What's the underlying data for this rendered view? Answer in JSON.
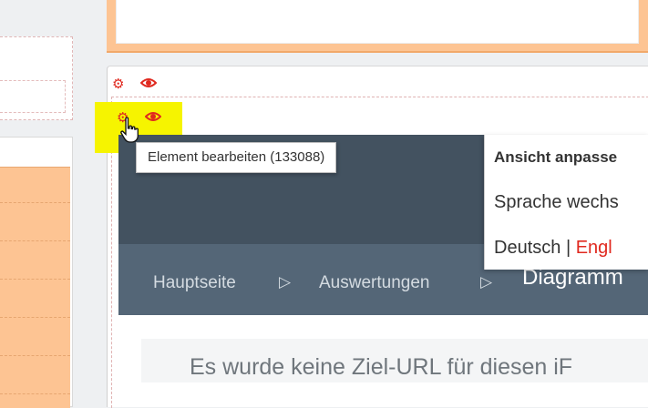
{
  "element_toolbar": {
    "edit_icon": "gear-icon",
    "view_icon": "eye-icon"
  },
  "tooltip": {
    "text": "Element bearbeiten (133088)"
  },
  "dropdown": {
    "title": "Ansicht anpasse",
    "language_label": "Sprache wechs",
    "lang_current": "Deutsch",
    "separator": "|",
    "lang_other": "Engl"
  },
  "breadcrumb": {
    "items": [
      "Hauptseite",
      "Auswertungen"
    ],
    "separator_icon": "triangle-right-icon",
    "current": "Diagramm"
  },
  "content": {
    "message": "Es wurde keine Ziel-URL für diesen iF"
  },
  "colors": {
    "accent_red": "#e0291f",
    "highlight_yellow": "#f6f400",
    "header_dark": "#435260",
    "nav_bar": "#546677",
    "orange_block": "#fdc493"
  }
}
